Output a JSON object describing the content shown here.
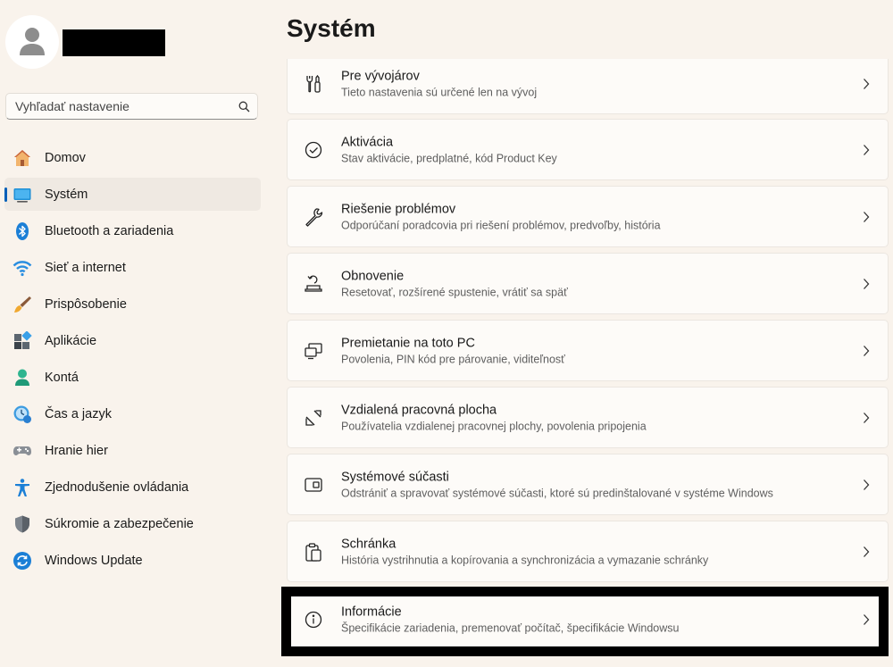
{
  "page": {
    "title": "Systém"
  },
  "search": {
    "placeholder": "Vyhľadať nastavenie",
    "icon": "search-icon"
  },
  "user": {
    "avatar_icon": "person-icon"
  },
  "sidebar": {
    "items": [
      {
        "label": "Domov",
        "icon": "home-icon"
      },
      {
        "label": "Systém",
        "icon": "system-display-icon",
        "active": true
      },
      {
        "label": "Bluetooth a zariadenia",
        "icon": "bluetooth-icon"
      },
      {
        "label": "Sieť a internet",
        "icon": "wifi-icon"
      },
      {
        "label": "Prispôsobenie",
        "icon": "paintbrush-icon"
      },
      {
        "label": "Aplikácie",
        "icon": "apps-icon"
      },
      {
        "label": "Kontá",
        "icon": "account-icon"
      },
      {
        "label": "Čas a jazyk",
        "icon": "time-language-icon"
      },
      {
        "label": "Hranie hier",
        "icon": "gamepad-icon"
      },
      {
        "label": "Zjednodušenie ovládania",
        "icon": "accessibility-icon"
      },
      {
        "label": "Súkromie a zabezpečenie",
        "icon": "shield-icon"
      },
      {
        "label": "Windows Update",
        "icon": "windows-update-icon"
      }
    ]
  },
  "cards": [
    {
      "title": "Pre vývojárov",
      "subtitle": "Tieto nastavenia sú určené len na vývoj",
      "icon": "developer-tools-icon"
    },
    {
      "title": "Aktivácia",
      "subtitle": "Stav aktivácie, predplatné, kód Product Key",
      "icon": "check-circle-icon"
    },
    {
      "title": "Riešenie problémov",
      "subtitle": "Odporúčaní poradcovia pri riešení problémov, predvoľby, história",
      "icon": "wrench-icon"
    },
    {
      "title": "Obnovenie",
      "subtitle": "Resetovať, rozšírené spustenie, vrátiť sa späť",
      "icon": "recovery-icon"
    },
    {
      "title": "Premietanie na toto PC",
      "subtitle": "Povolenia, PIN kód pre párovanie, viditeľnosť",
      "icon": "projection-icon"
    },
    {
      "title": "Vzdialená pracovná plocha",
      "subtitle": "Používatelia vzdialenej pracovnej plochy, povolenia pripojenia",
      "icon": "remote-desktop-icon"
    },
    {
      "title": "Systémové súčasti",
      "subtitle": "Odstrániť a spravovať systémové súčasti, ktoré sú predinštalované v systéme Windows",
      "icon": "system-components-icon"
    },
    {
      "title": "Schránka",
      "subtitle": "História vystrihnutia a kopírovania a synchronizácia a vymazanie schránky",
      "icon": "clipboard-icon"
    },
    {
      "title": "Informácie",
      "subtitle": "Špecifikácie zariadenia, premenovať počítač, špecifikácie Windowsu",
      "icon": "info-icon",
      "highlighted": true
    }
  ],
  "colors": {
    "accent": "#005fb8",
    "background": "#f9f3ec",
    "card": "#fdfbf8"
  }
}
